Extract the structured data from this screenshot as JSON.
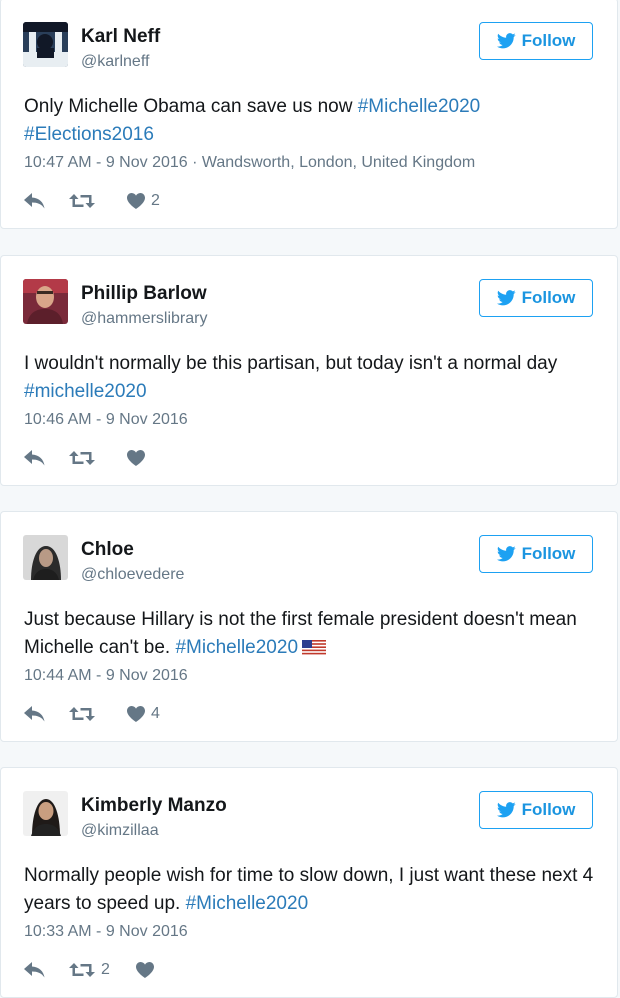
{
  "colors": {
    "accent": "#1da1f2",
    "link": "#2b7bb9",
    "muted": "#657786",
    "border": "#e1e8ed"
  },
  "tweets": [
    {
      "name": "Karl Neff",
      "handle": "@karlneff",
      "follow_label": "Follow",
      "text": "Only Michelle Obama can save us now ",
      "hashtags": [
        "#Michelle2020",
        "#Elections2016"
      ],
      "timestamp": "10:47 AM - 9 Nov 2016 · Wandsworth, London, United Kingdom",
      "likes": "2",
      "retweets": ""
    },
    {
      "name": "Phillip Barlow",
      "handle": "@hammerslibrary",
      "follow_label": "Follow",
      "text": "I wouldn't normally be this partisan, but today isn't a normal day ",
      "hashtags": [
        "#michelle2020"
      ],
      "timestamp": "10:46 AM - 9 Nov 2016",
      "likes": "",
      "retweets": ""
    },
    {
      "name": "Chloe",
      "handle": "@chloevedere",
      "follow_label": "Follow",
      "text": "Just because Hillary is not the first female president doesn't mean Michelle can't be. ",
      "hashtags": [
        "#Michelle2020"
      ],
      "emoji": "us-flag-icon",
      "timestamp": "10:44 AM - 9 Nov 2016",
      "likes": "4",
      "retweets": ""
    },
    {
      "name": "Kimberly Manzo",
      "handle": "@kimzillaa",
      "follow_label": "Follow",
      "text": "Normally people wish for time to slow down, I just want these next 4 years to speed up. ",
      "hashtags": [
        "#Michelle2020"
      ],
      "timestamp": "10:33 AM - 9 Nov 2016",
      "likes": "",
      "retweets": "2"
    }
  ],
  "icons": {
    "follow": "twitter-bird-icon",
    "reply": "reply-icon",
    "retweet": "retweet-icon",
    "like": "heart-icon"
  }
}
